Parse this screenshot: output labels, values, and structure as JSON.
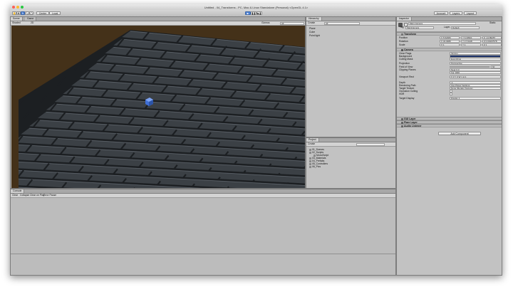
{
  "window": {
    "title": "Untitled - 04_Transforms - PC, Mac & Linux Standalone (Personal) <OpenGL 4.1>"
  },
  "toolbar": {
    "tools": [
      "hand-icon",
      "move-icon",
      "rotate-icon",
      "scale-icon",
      "rect-icon"
    ],
    "pivot_label": "Center",
    "space_label": "Local",
    "play_controls": [
      "play-icon",
      "pause-icon",
      "step-icon"
    ],
    "account_label": "Account",
    "layers_label": "Layers",
    "layout_label": "Layout"
  },
  "scene": {
    "tabs": [
      "Scene",
      "Game"
    ],
    "shading_label": "Shaded",
    "mode_label": "2D",
    "audio_label": "",
    "gizmos_label": "Gizmos",
    "search_placeholder": "All",
    "colors": {
      "background": "#443119",
      "tile": "#3b4045",
      "mortar": "#1c1f22",
      "cube": "#3f6fd6"
    }
  },
  "hierarchy": {
    "tab_label": "Hierarchy",
    "create_label": "Create",
    "search_placeholder": "All",
    "items": [
      "Plane",
      "Cube",
      "Point light"
    ]
  },
  "project": {
    "tab_label": "Project",
    "create_label": "Create",
    "items": [
      "01_Scenes",
      "02_Scripts",
      "MonoScript",
      "03_Materials",
      "04_Prefabs",
      "05_Controllers",
      "06_Pics"
    ]
  },
  "console": {
    "tab_label": "Console",
    "buttons": [
      "Clear",
      "Collapse",
      "Clear on Play",
      "Error Pause"
    ]
  },
  "inspector": {
    "tab_label": "Inspector",
    "object_name": "Main Camera",
    "static_label": "Static",
    "tag_label": "Tag",
    "tag_value": "MainCamera",
    "layer_label": "Layer",
    "layer_value": "Default",
    "transform": {
      "header": "Transform",
      "position_label": "Position",
      "rotation_label": "Rotation",
      "scale_label": "Scale",
      "position": [
        "X 5.52383",
        "Y 6.30521",
        "Z -14.89457"
      ],
      "rotation": [
        "X 34.0389",
        "Y 17.6148",
        "Z 0.00197578"
      ],
      "scale": [
        "X 1",
        "Y 1",
        "Z 1"
      ]
    },
    "camera": {
      "header": "Camera",
      "rows": [
        {
          "label": "Clear Flags",
          "value": "Skybox"
        },
        {
          "label": "Background",
          "value": ""
        },
        {
          "label": "Culling Mask",
          "value": "Everything"
        },
        {
          "label": "Projection",
          "value": "Perspective"
        },
        {
          "label": "Field of View",
          "value": "60"
        },
        {
          "label": "Clipping Planes",
          "value": "Near 0.3"
        },
        {
          "label": "",
          "value": "Far 1000"
        },
        {
          "label": "Viewport Rect",
          "value": "X 0  Y 0  W 1  H 1"
        },
        {
          "label": "Depth",
          "value": "-1"
        },
        {
          "label": "Rendering Path",
          "value": "Use Player Settings"
        },
        {
          "label": "Target Texture",
          "value": "None (Render Texture)"
        },
        {
          "label": "Occlusion Culling",
          "value": ""
        },
        {
          "label": "HDR",
          "value": ""
        },
        {
          "label": "Target Display",
          "value": "Display 1"
        }
      ]
    },
    "components": [
      "GUI Layer",
      "Flare Layer",
      "Audio Listener"
    ],
    "add_component_label": "Add Component"
  }
}
